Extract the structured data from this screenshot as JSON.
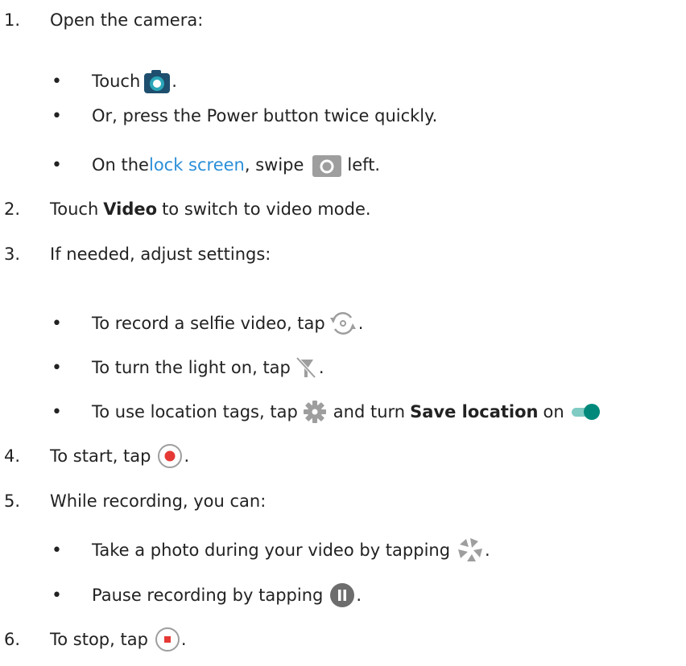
{
  "steps": [
    {
      "num": "1.",
      "text": "Open the camera:"
    },
    {
      "num": "2.",
      "pre": "Touch ",
      "bold": "Video",
      "post": " to switch to video mode."
    },
    {
      "num": "3.",
      "text": "If needed, adjust settings:"
    },
    {
      "num": "4.",
      "pre": "To start, tap",
      "post": "."
    },
    {
      "num": "5.",
      "text": "While recording, you can:"
    },
    {
      "num": "6.",
      "pre": "To stop, tap",
      "post": "."
    }
  ],
  "bullets": {
    "touch": {
      "pre": "Touch",
      "post": "."
    },
    "power": {
      "text": "Or, press the Power button twice quickly."
    },
    "lock": {
      "pre": "On the ",
      "link": "lock screen",
      "mid": ", swipe",
      "post": "left."
    },
    "selfie": {
      "pre": "To record a selfie video, tap",
      "post": "."
    },
    "light": {
      "pre": "To turn the light on, tap",
      "post": "."
    },
    "location": {
      "pre": "To use location tags, tap",
      "mid": "and turn ",
      "bold": "Save location",
      "post": " on"
    },
    "photo": {
      "pre": "Take a photo during your video by tapping",
      "post": "."
    },
    "pause": {
      "pre": "Pause recording by tapping",
      "post": "."
    }
  },
  "bullet_char": "•",
  "icons": [
    "camera-app-icon",
    "camera-lock-icon",
    "switch-camera-icon",
    "flash-off-icon",
    "settings-gear-icon",
    "toggle-on-icon",
    "record-icon",
    "shutter-icon",
    "pause-icon",
    "stop-icon"
  ],
  "colors": {
    "text": "#222222",
    "link": "#2a8fd8",
    "record": "#e53935",
    "toggle": "#00897b",
    "camera_dark": "#1e4f6e"
  }
}
